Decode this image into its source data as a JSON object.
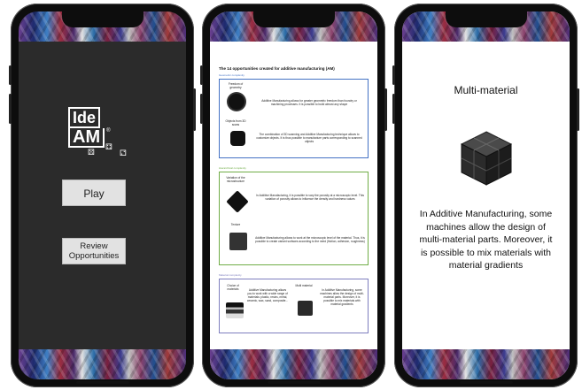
{
  "phone1": {
    "logo": {
      "line1": "Ide",
      "line2": "AM",
      "tm": "®"
    },
    "play_label": "Play",
    "review_label": "Review Opportunities"
  },
  "phone2": {
    "title": "The 14 opportunities created for additive manufacturing (AM)",
    "sections": [
      {
        "label": "Geometric complexity",
        "color": "#4472c4",
        "items": [
          {
            "label": "Freedom of geometry",
            "text": "Additive Manufacturing allows for greater geometric freedom than foundry or machining processes. It is possible to build almost any shape"
          },
          {
            "label": "Objects from 3D scans",
            "text": "The combination of 3D scanning and Additive Manufacturing technique allows to customize objects. It is thus possible to manufacture parts corresponding to scanned objects"
          }
        ]
      },
      {
        "label": "Hierarchical complexity",
        "color": "#70ad47",
        "items": [
          {
            "label": "Variation of the microstructure",
            "text": "In Additive Manufacturing, it is possible to vary the porosity at a microscopic level. This variation of porosity allows to influence the density and hardness values"
          },
          {
            "label": "Texture",
            "text": "Additive Manufacturing allows to work at the microscopic level of the material. Thus, it is possible to create variant surfaces according to the need (friction, adhesion, roughness)"
          }
        ]
      },
      {
        "label": "Material complexity",
        "color": "#7f7fbf",
        "items": [
          {
            "label": "Choice of materials",
            "text": "Additive Manufacturing allows you to work with a wide range of materials: plastic, resins, metal, ceramic, wax, sand, composite..."
          },
          {
            "label": "Multi material",
            "text": "In Additive Manufacturing, some machines allow the design of multi-material parts. Moreover, it is possible to mix materials with material gradients"
          }
        ]
      }
    ]
  },
  "phone3": {
    "title": "Multi-material",
    "text": "In Additive Manufacturing, some machines allow the design of multi-material parts. Moreover, it is possible to mix materials with material gradients"
  }
}
